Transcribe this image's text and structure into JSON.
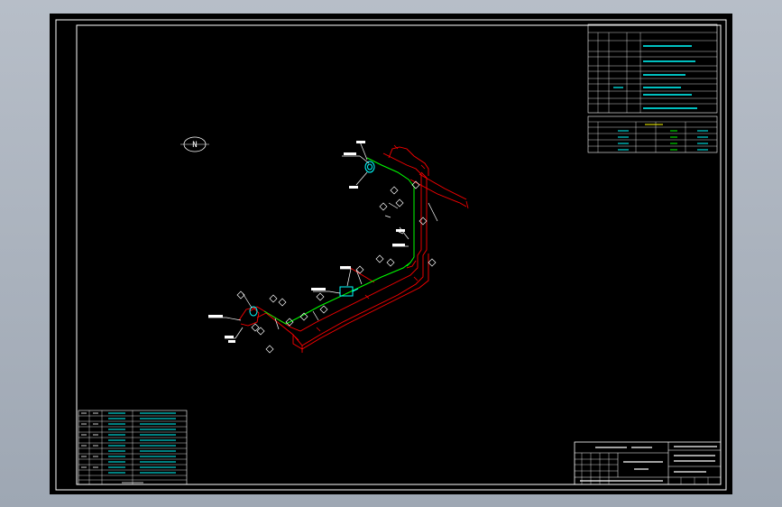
{
  "colors": {
    "background": "#000000",
    "frame": "#ffffff",
    "pipe_primary": "#00ff00",
    "pipe_secondary": "#ff0000",
    "annotation": "#00ffff",
    "label": "#ffffff",
    "window_bg": "#a9b1bc"
  },
  "icons": {
    "north_arrow": "north-arrow-icon"
  },
  "drawing": {
    "north_symbol": "N"
  }
}
